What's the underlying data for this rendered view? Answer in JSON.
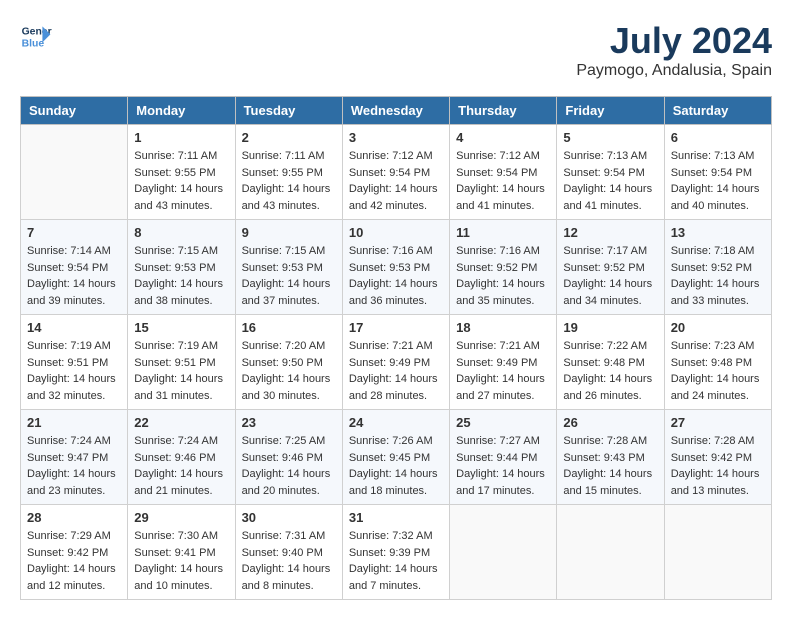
{
  "header": {
    "logo_line1": "General",
    "logo_line2": "Blue",
    "month": "July 2024",
    "location": "Paymogo, Andalusia, Spain"
  },
  "weekdays": [
    "Sunday",
    "Monday",
    "Tuesday",
    "Wednesday",
    "Thursday",
    "Friday",
    "Saturday"
  ],
  "weeks": [
    [
      {
        "day": "",
        "sunrise": "",
        "sunset": "",
        "daylight": ""
      },
      {
        "day": "1",
        "sunrise": "Sunrise: 7:11 AM",
        "sunset": "Sunset: 9:55 PM",
        "daylight": "Daylight: 14 hours and 43 minutes."
      },
      {
        "day": "2",
        "sunrise": "Sunrise: 7:11 AM",
        "sunset": "Sunset: 9:55 PM",
        "daylight": "Daylight: 14 hours and 43 minutes."
      },
      {
        "day": "3",
        "sunrise": "Sunrise: 7:12 AM",
        "sunset": "Sunset: 9:54 PM",
        "daylight": "Daylight: 14 hours and 42 minutes."
      },
      {
        "day": "4",
        "sunrise": "Sunrise: 7:12 AM",
        "sunset": "Sunset: 9:54 PM",
        "daylight": "Daylight: 14 hours and 41 minutes."
      },
      {
        "day": "5",
        "sunrise": "Sunrise: 7:13 AM",
        "sunset": "Sunset: 9:54 PM",
        "daylight": "Daylight: 14 hours and 41 minutes."
      },
      {
        "day": "6",
        "sunrise": "Sunrise: 7:13 AM",
        "sunset": "Sunset: 9:54 PM",
        "daylight": "Daylight: 14 hours and 40 minutes."
      }
    ],
    [
      {
        "day": "7",
        "sunrise": "Sunrise: 7:14 AM",
        "sunset": "Sunset: 9:54 PM",
        "daylight": "Daylight: 14 hours and 39 minutes."
      },
      {
        "day": "8",
        "sunrise": "Sunrise: 7:15 AM",
        "sunset": "Sunset: 9:53 PM",
        "daylight": "Daylight: 14 hours and 38 minutes."
      },
      {
        "day": "9",
        "sunrise": "Sunrise: 7:15 AM",
        "sunset": "Sunset: 9:53 PM",
        "daylight": "Daylight: 14 hours and 37 minutes."
      },
      {
        "day": "10",
        "sunrise": "Sunrise: 7:16 AM",
        "sunset": "Sunset: 9:53 PM",
        "daylight": "Daylight: 14 hours and 36 minutes."
      },
      {
        "day": "11",
        "sunrise": "Sunrise: 7:16 AM",
        "sunset": "Sunset: 9:52 PM",
        "daylight": "Daylight: 14 hours and 35 minutes."
      },
      {
        "day": "12",
        "sunrise": "Sunrise: 7:17 AM",
        "sunset": "Sunset: 9:52 PM",
        "daylight": "Daylight: 14 hours and 34 minutes."
      },
      {
        "day": "13",
        "sunrise": "Sunrise: 7:18 AM",
        "sunset": "Sunset: 9:52 PM",
        "daylight": "Daylight: 14 hours and 33 minutes."
      }
    ],
    [
      {
        "day": "14",
        "sunrise": "Sunrise: 7:19 AM",
        "sunset": "Sunset: 9:51 PM",
        "daylight": "Daylight: 14 hours and 32 minutes."
      },
      {
        "day": "15",
        "sunrise": "Sunrise: 7:19 AM",
        "sunset": "Sunset: 9:51 PM",
        "daylight": "Daylight: 14 hours and 31 minutes."
      },
      {
        "day": "16",
        "sunrise": "Sunrise: 7:20 AM",
        "sunset": "Sunset: 9:50 PM",
        "daylight": "Daylight: 14 hours and 30 minutes."
      },
      {
        "day": "17",
        "sunrise": "Sunrise: 7:21 AM",
        "sunset": "Sunset: 9:49 PM",
        "daylight": "Daylight: 14 hours and 28 minutes."
      },
      {
        "day": "18",
        "sunrise": "Sunrise: 7:21 AM",
        "sunset": "Sunset: 9:49 PM",
        "daylight": "Daylight: 14 hours and 27 minutes."
      },
      {
        "day": "19",
        "sunrise": "Sunrise: 7:22 AM",
        "sunset": "Sunset: 9:48 PM",
        "daylight": "Daylight: 14 hours and 26 minutes."
      },
      {
        "day": "20",
        "sunrise": "Sunrise: 7:23 AM",
        "sunset": "Sunset: 9:48 PM",
        "daylight": "Daylight: 14 hours and 24 minutes."
      }
    ],
    [
      {
        "day": "21",
        "sunrise": "Sunrise: 7:24 AM",
        "sunset": "Sunset: 9:47 PM",
        "daylight": "Daylight: 14 hours and 23 minutes."
      },
      {
        "day": "22",
        "sunrise": "Sunrise: 7:24 AM",
        "sunset": "Sunset: 9:46 PM",
        "daylight": "Daylight: 14 hours and 21 minutes."
      },
      {
        "day": "23",
        "sunrise": "Sunrise: 7:25 AM",
        "sunset": "Sunset: 9:46 PM",
        "daylight": "Daylight: 14 hours and 20 minutes."
      },
      {
        "day": "24",
        "sunrise": "Sunrise: 7:26 AM",
        "sunset": "Sunset: 9:45 PM",
        "daylight": "Daylight: 14 hours and 18 minutes."
      },
      {
        "day": "25",
        "sunrise": "Sunrise: 7:27 AM",
        "sunset": "Sunset: 9:44 PM",
        "daylight": "Daylight: 14 hours and 17 minutes."
      },
      {
        "day": "26",
        "sunrise": "Sunrise: 7:28 AM",
        "sunset": "Sunset: 9:43 PM",
        "daylight": "Daylight: 14 hours and 15 minutes."
      },
      {
        "day": "27",
        "sunrise": "Sunrise: 7:28 AM",
        "sunset": "Sunset: 9:42 PM",
        "daylight": "Daylight: 14 hours and 13 minutes."
      }
    ],
    [
      {
        "day": "28",
        "sunrise": "Sunrise: 7:29 AM",
        "sunset": "Sunset: 9:42 PM",
        "daylight": "Daylight: 14 hours and 12 minutes."
      },
      {
        "day": "29",
        "sunrise": "Sunrise: 7:30 AM",
        "sunset": "Sunset: 9:41 PM",
        "daylight": "Daylight: 14 hours and 10 minutes."
      },
      {
        "day": "30",
        "sunrise": "Sunrise: 7:31 AM",
        "sunset": "Sunset: 9:40 PM",
        "daylight": "Daylight: 14 hours and 8 minutes."
      },
      {
        "day": "31",
        "sunrise": "Sunrise: 7:32 AM",
        "sunset": "Sunset: 9:39 PM",
        "daylight": "Daylight: 14 hours and 7 minutes."
      },
      {
        "day": "",
        "sunrise": "",
        "sunset": "",
        "daylight": ""
      },
      {
        "day": "",
        "sunrise": "",
        "sunset": "",
        "daylight": ""
      },
      {
        "day": "",
        "sunrise": "",
        "sunset": "",
        "daylight": ""
      }
    ]
  ]
}
